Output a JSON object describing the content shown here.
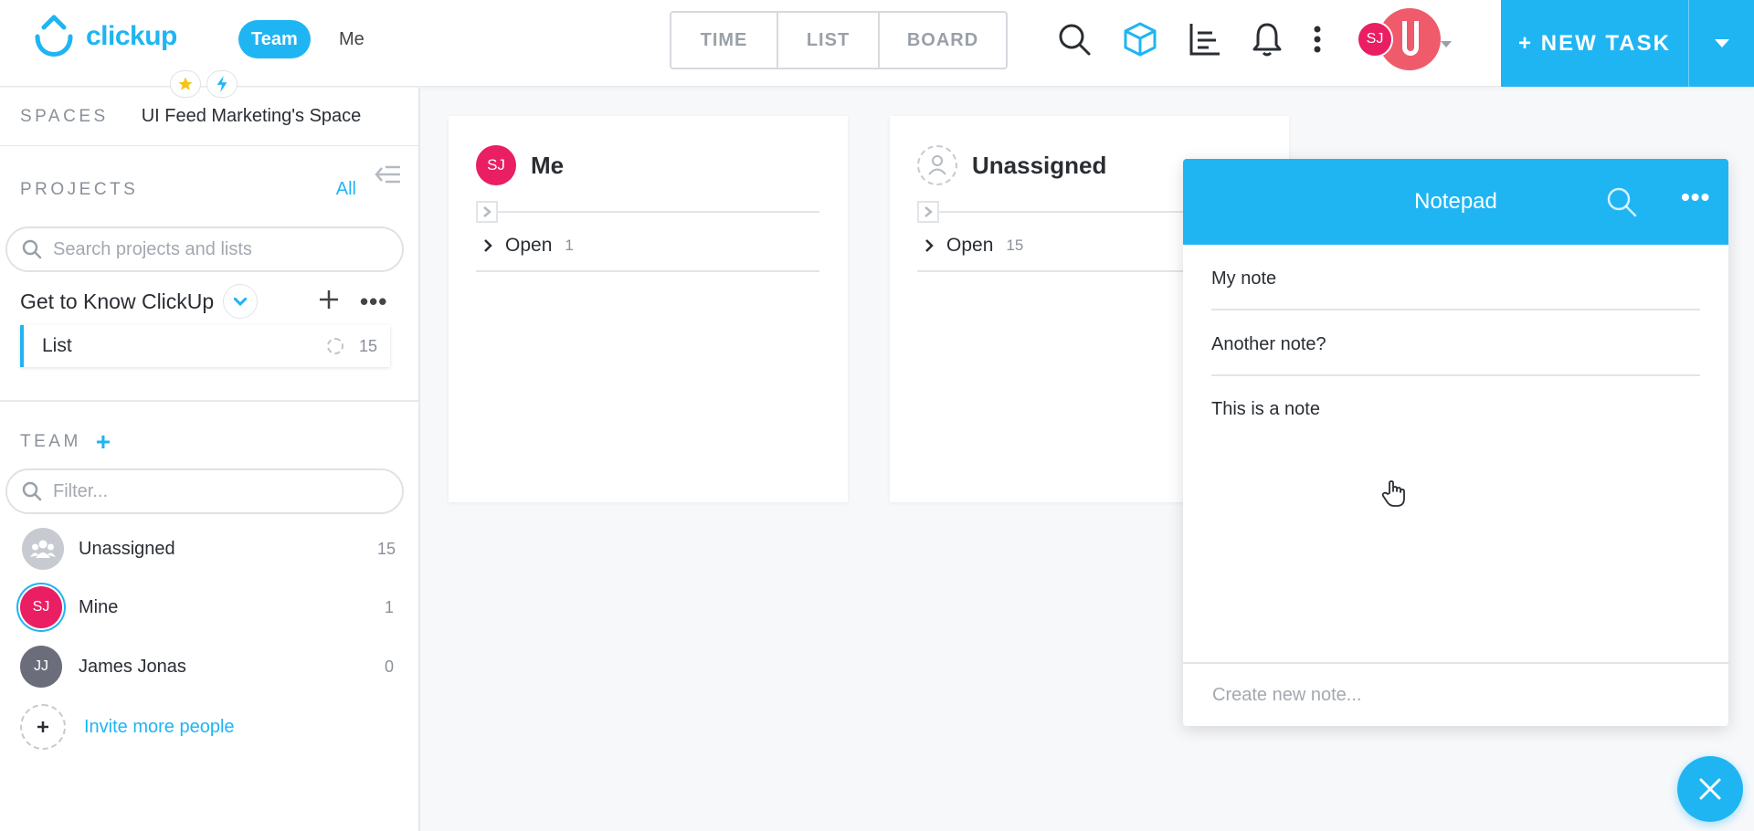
{
  "header": {
    "logo_text": "clickup",
    "team_label": "Team",
    "me_label": "Me",
    "views": [
      "TIME",
      "LIST",
      "BOARD"
    ],
    "avatar_initials": "SJ",
    "new_task_label": "+ NEW TASK",
    "icons": [
      "search-icon",
      "box-icon",
      "chart-icon",
      "bell-icon",
      "kebab-icon"
    ]
  },
  "sidebar": {
    "spaces_label": "SPACES",
    "space_name": "UI Feed Marketing's Space",
    "projects_label": "PROJECTS",
    "all_label": "All",
    "search_placeholder": "Search projects and lists",
    "project_name": "Get to Know ClickUp",
    "project_more": "•••",
    "list": {
      "name": "List",
      "count": "15"
    },
    "team_label": "TEAM",
    "team_plus": "+",
    "filter_placeholder": "Filter...",
    "members": [
      {
        "initials": "",
        "name": "Unassigned",
        "count": "15"
      },
      {
        "initials": "SJ",
        "name": "Mine",
        "count": "1"
      },
      {
        "initials": "JJ",
        "name": "James Jonas",
        "count": "0"
      }
    ],
    "invite_label": "Invite more people"
  },
  "board": {
    "columns": [
      {
        "initials": "SJ",
        "title": "Me",
        "group": "Open",
        "count": "1"
      },
      {
        "initials": "",
        "title": "Unassigned",
        "group": "Open",
        "count": "15"
      }
    ]
  },
  "notepad": {
    "title": "Notepad",
    "more": "•••",
    "notes": [
      "My note",
      "Another note?",
      "This is a note"
    ],
    "new_note_placeholder": "Create new note..."
  },
  "colors": {
    "accent": "#1fb5f3",
    "avatar_pink": "#e91e63",
    "avatar_gray": "#6b6e7a"
  }
}
